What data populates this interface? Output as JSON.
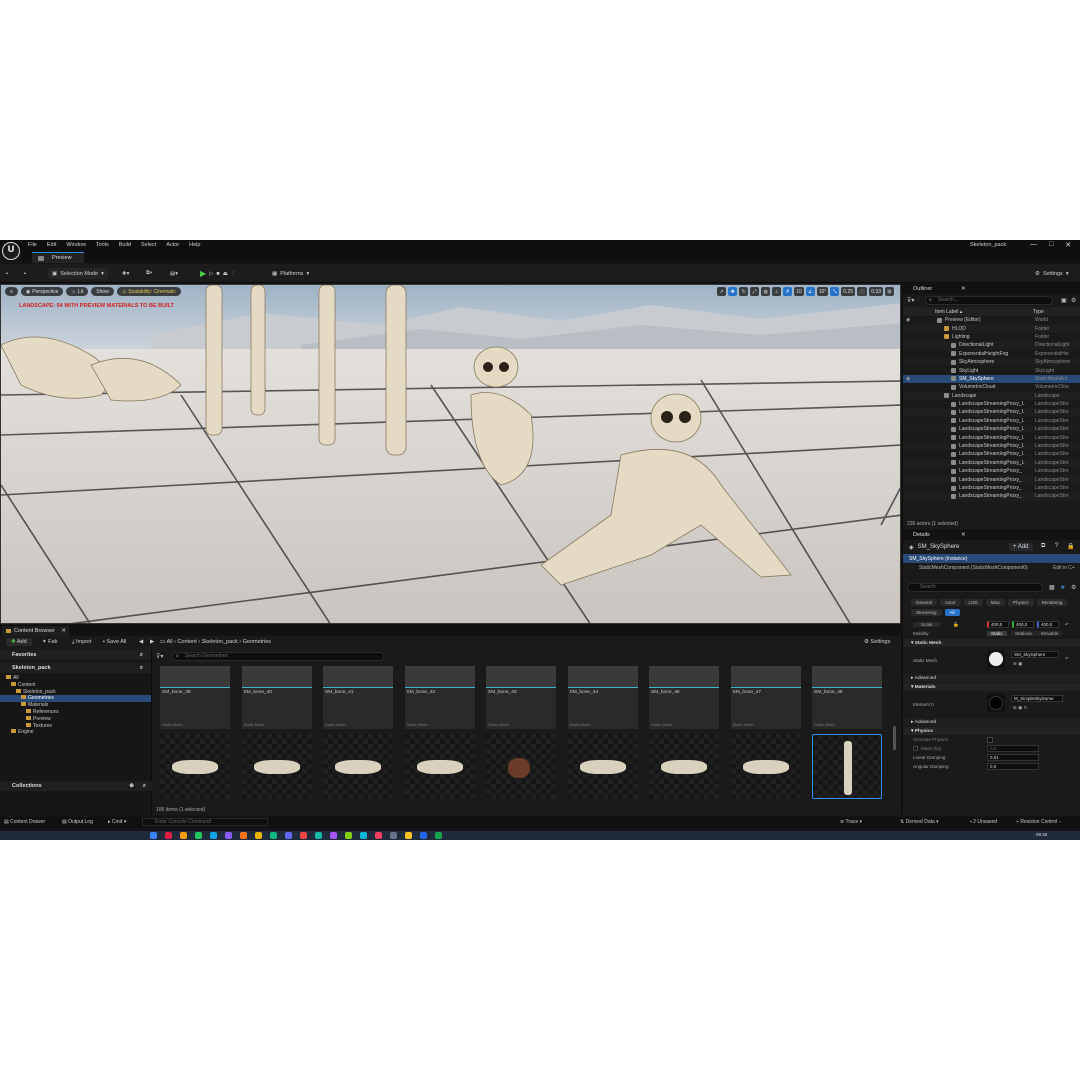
{
  "app": {
    "logo_text": "U",
    "project_name": "Skeleton_pack",
    "menus": [
      "File",
      "Edit",
      "Window",
      "Tools",
      "Build",
      "Select",
      "Actor",
      "Help"
    ],
    "tab": "Preview",
    "window_buttons": [
      "—",
      "□",
      "✕"
    ]
  },
  "toolbar": {
    "selection_mode": "Selection Mode",
    "platforms": "Platforms",
    "settings": "Settings"
  },
  "viewport": {
    "perspective": "Perspective",
    "lit": "Lit",
    "show": "Show",
    "scalability": "Scalability: Cinematic",
    "warning": "LANDSCAPE: 54 WITH PREVIEW MATERIALS TO BE BUILT",
    "grid_snap": "10",
    "rot_snap": "10°",
    "scale_snap": "0.25",
    "cam_speed": "0.33"
  },
  "outliner": {
    "tab": "Outliner",
    "search_placeholder": "Search...",
    "col_label": "Item Label ▴",
    "col_type": "Type",
    "rows": [
      {
        "label": "Preview (Editor)",
        "type": "World",
        "depth": 0,
        "folder": false
      },
      {
        "label": "HLOD",
        "type": "Folder",
        "depth": 1,
        "folder": true
      },
      {
        "label": "Lighting",
        "type": "Folder",
        "depth": 1,
        "folder": true
      },
      {
        "label": "DirectionalLight",
        "type": "DirectionalLight",
        "depth": 2,
        "folder": false
      },
      {
        "label": "ExponentialHeightFog",
        "type": "ExponentialHei",
        "depth": 2,
        "folder": false
      },
      {
        "label": "SkyAtmosphere",
        "type": "SkyAtmosphere",
        "depth": 2,
        "folder": false
      },
      {
        "label": "SkyLight",
        "type": "SkyLight",
        "depth": 2,
        "folder": false
      },
      {
        "label": "SM_SkySphere",
        "type": "StaticMeshAct",
        "depth": 2,
        "folder": false,
        "selected": true
      },
      {
        "label": "VolumetricCloud",
        "type": "VolumetricClou",
        "depth": 2,
        "folder": false
      },
      {
        "label": "Landscape",
        "type": "Landscape",
        "depth": 1,
        "folder": false
      },
      {
        "label": "LandscapeStreamingProxy_L",
        "type": "LandscapeStre",
        "depth": 2,
        "folder": false
      },
      {
        "label": "LandscapeStreamingProxy_L",
        "type": "LandscapeStre",
        "depth": 2,
        "folder": false
      },
      {
        "label": "LandscapeStreamingProxy_L",
        "type": "LandscapeStre",
        "depth": 2,
        "folder": false
      },
      {
        "label": "LandscapeStreamingProxy_L",
        "type": "LandscapeStre",
        "depth": 2,
        "folder": false
      },
      {
        "label": "LandscapeStreamingProxy_L",
        "type": "LandscapeStre",
        "depth": 2,
        "folder": false
      },
      {
        "label": "LandscapeStreamingProxy_L",
        "type": "LandscapeStre",
        "depth": 2,
        "folder": false
      },
      {
        "label": "LandscapeStreamingProxy_L",
        "type": "LandscapeStre",
        "depth": 2,
        "folder": false
      },
      {
        "label": "LandscapeStreamingProxy_L",
        "type": "LandscapeStre",
        "depth": 2,
        "folder": false
      },
      {
        "label": "LandscapeStreamingProxy_",
        "type": "LandscapeStre",
        "depth": 2,
        "folder": false
      },
      {
        "label": "LandscapeStreamingProxy_",
        "type": "LandscapeStre",
        "depth": 2,
        "folder": false
      },
      {
        "label": "LandscapeStreamingProxy_",
        "type": "LandscapeStre",
        "depth": 2,
        "folder": false
      },
      {
        "label": "LandscapeStreamingProxy_",
        "type": "LandscapeStre",
        "depth": 2,
        "folder": false
      }
    ],
    "footer": "230 actors (1 selected)"
  },
  "details": {
    "tab": "Details",
    "actor": "SM_SkySphere",
    "add": "+ Add",
    "instance": "SM_SkySphere (Instance)",
    "component": "StaticMeshComponent (StaticMeshComponent0)",
    "edit_in": "Edit in C+",
    "search_placeholder": "Search",
    "categories": [
      "General",
      "Actor",
      "LOD",
      "Misc",
      "Physics",
      "Rendering",
      "Streaming",
      "All"
    ],
    "scale_label": "Scale",
    "scale": [
      "400,0",
      "400,0",
      "400,0"
    ],
    "mobility_label": "Mobility",
    "mobility": [
      "Static",
      "Stationa",
      "Movable"
    ],
    "sec_static_mesh": "Static Mesh",
    "static_mesh_label": "Static Mesh",
    "static_mesh_value": "SM_SkySphere",
    "sec_advanced": "Advanced",
    "sec_materials": "Materials",
    "element_label": "Element 0",
    "material_value": "M_SimpleSkyDome",
    "sec_advanced2": "Advanced",
    "sec_physics": "Physics",
    "simulate_physics": "Simulate Physics",
    "mass_kg": "Mass (kg)",
    "mass_value": "0,0",
    "linear_damping": "Linear Damping",
    "linear_value": "0,01",
    "angular_damping": "Angular Damping",
    "angular_value": "0,0"
  },
  "content_browser": {
    "tab": "Content Browser",
    "add": "Add",
    "fab": "Fab",
    "import": "Import",
    "save_all": "Save All",
    "breadcrumb": [
      "All",
      "Content",
      "Skeleton_pack",
      "Geometries"
    ],
    "settings": "Settings",
    "favorites": "Favorites",
    "root": "Skeleton_pack",
    "search_placeholder": "Search Geometries",
    "tree": [
      {
        "label": "All",
        "depth": 0
      },
      {
        "label": "Content",
        "depth": 1
      },
      {
        "label": "Skeleton_pack",
        "depth": 2
      },
      {
        "label": "Geometries",
        "depth": 3,
        "selected": true
      },
      {
        "label": "Materials",
        "depth": 3
      },
      {
        "label": "References",
        "depth": 4
      },
      {
        "label": "Preview",
        "depth": 4
      },
      {
        "label": "Textures",
        "depth": 4
      },
      {
        "label": "Engine",
        "depth": 1
      }
    ],
    "collections": "Collections",
    "items": [
      {
        "name": "SM_bone_39",
        "type": "Static Mesh"
      },
      {
        "name": "SM_bone_40",
        "type": "Static Mesh"
      },
      {
        "name": "SM_bone_41",
        "type": "Static Mesh"
      },
      {
        "name": "SM_bone_42",
        "type": "Static Mesh"
      },
      {
        "name": "SM_bone_43",
        "type": "Static Mesh"
      },
      {
        "name": "SM_bone_44",
        "type": "Static Mesh"
      },
      {
        "name": "SM_bone_46",
        "type": "Static Mesh"
      },
      {
        "name": "SM_bone_47",
        "type": "Static Mesh"
      },
      {
        "name": "SM_bone_48",
        "type": "Static Mesh"
      }
    ],
    "status": "106 items (1 selected)"
  },
  "statusbar": {
    "content_drawer": "Content Drawer",
    "output_log": "Output Log",
    "cmd": "Cmd",
    "console_placeholder": "Enter Console Command",
    "trace": "Trace",
    "derived_data": "Derived Data",
    "unsaved": "2 Unsaved",
    "revision": "Revision Control",
    "clock": "09:48"
  }
}
